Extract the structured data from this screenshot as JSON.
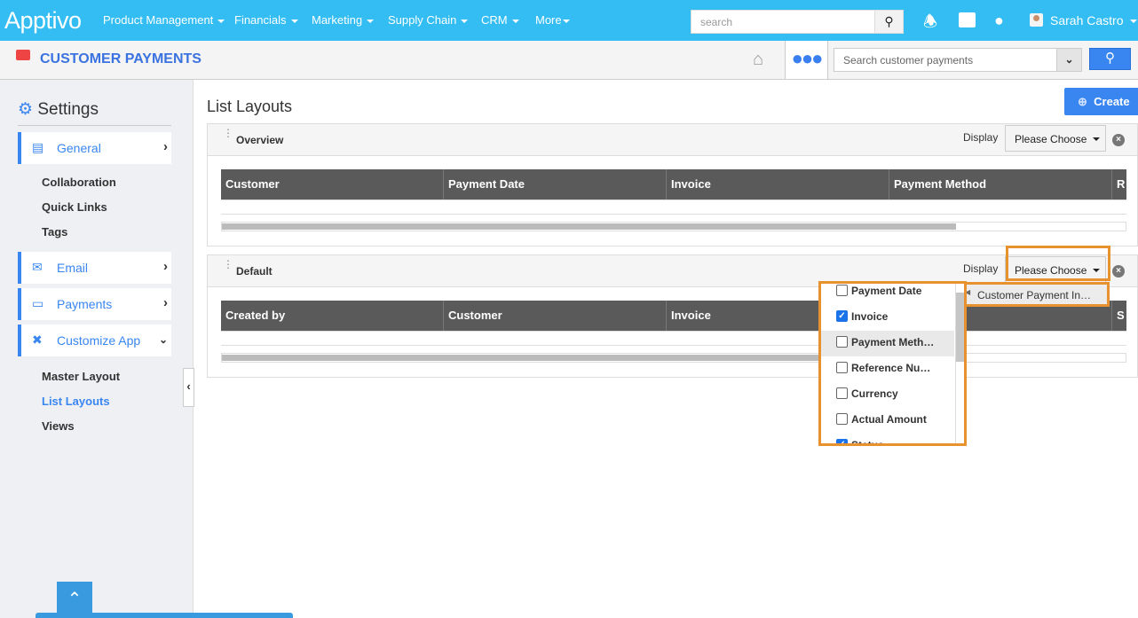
{
  "topbar": {
    "logo": "Apptivo",
    "nav": [
      "Product Management",
      "Financials",
      "Marketing",
      "Supply Chain",
      "CRM",
      "More"
    ],
    "search_placeholder": "search",
    "user": "Sarah Castro",
    "brand_color": "#33bdf2"
  },
  "subbar": {
    "module_title": "CUSTOMER PAYMENTS",
    "search_placeholder": "Search customer payments"
  },
  "sidebar": {
    "title": "Settings",
    "sections": [
      {
        "label": "General",
        "icon": "monitor-icon"
      },
      {
        "label": "Email",
        "icon": "envelope-icon"
      },
      {
        "label": "Payments",
        "icon": "credit-card-icon"
      },
      {
        "label": "Customize App",
        "icon": "tools-icon"
      }
    ],
    "general_links": [
      "Collaboration",
      "Quick Links",
      "Tags"
    ],
    "customize_links": [
      "Master Layout",
      "List Layouts",
      "Views"
    ]
  },
  "main": {
    "title": "List Layouts",
    "create_label": "Create",
    "panels": [
      {
        "title": "Overview",
        "display_label": "Display",
        "select_value": "Please Choose",
        "columns": [
          "Customer",
          "Payment Date",
          "Invoice",
          "Payment Method",
          "R"
        ]
      },
      {
        "title": "Default",
        "display_label": "Display",
        "select_value": "Please Choose",
        "columns": [
          "Created by",
          "Customer",
          "Invoice",
          "",
          "S"
        ]
      }
    ]
  },
  "dropdown": {
    "options": [
      {
        "label": "Payment Date",
        "checked": false
      },
      {
        "label": "Invoice",
        "checked": true
      },
      {
        "label": "Payment Meth…",
        "checked": false
      },
      {
        "label": "Reference Nu…",
        "checked": false
      },
      {
        "label": "Currency",
        "checked": false
      },
      {
        "label": "Actual Amount",
        "checked": false
      },
      {
        "label": "Status",
        "checked": true
      }
    ],
    "submenu": "Customer Payment In…"
  }
}
